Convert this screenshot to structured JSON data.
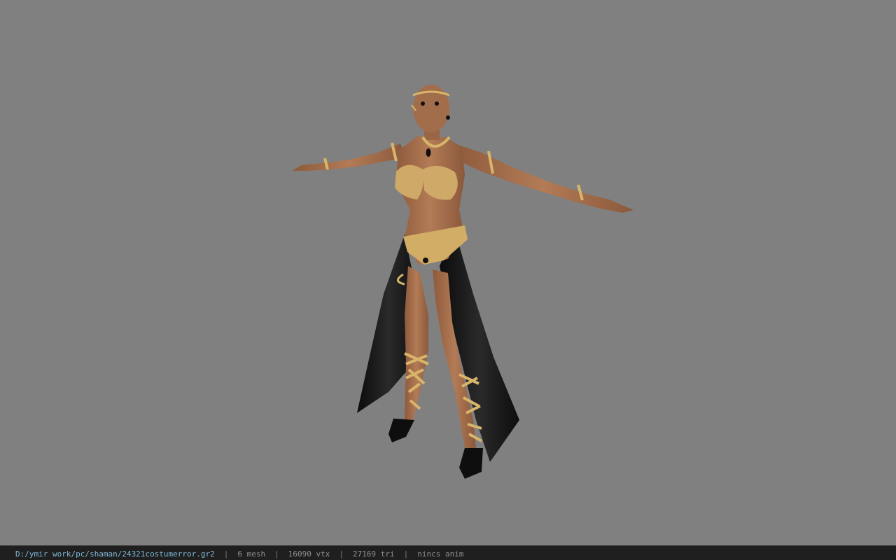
{
  "viewer": {
    "background_color": "#808080",
    "status_bar": {
      "file_path": "D:/ymir work/pc/shaman/24321costumerror.gr2",
      "separator": "|",
      "mesh_count": "6 mesh",
      "vertex_count": "16090 vtx",
      "triangle_count": "27169 tri",
      "animation": "nincs anim"
    }
  },
  "model": {
    "subject": "female shaman character in T-pose wearing gold ornate costume with black skirt",
    "skin_color": "#a8714f",
    "gold_color": "#d8b56a",
    "cloth_color": "#141414"
  }
}
